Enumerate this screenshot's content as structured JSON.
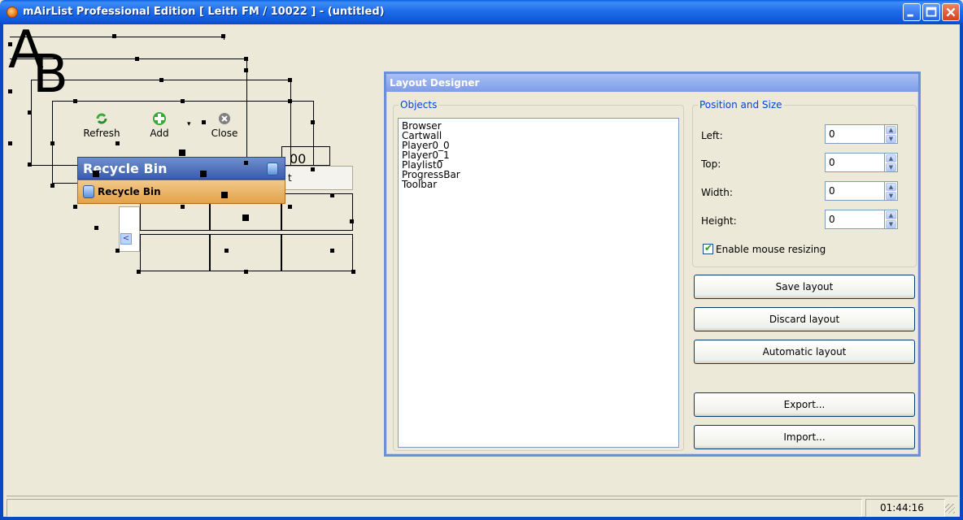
{
  "window": {
    "title": "mAirList Professional Edition [ Leith FM / 10022 ] - (untitled)",
    "controls": {
      "minimize": "minimize",
      "maximize": "maximize",
      "close": "close"
    }
  },
  "canvas": {
    "letter_a": "A",
    "letter_b": "B",
    "toolbar": {
      "refresh": "Refresh",
      "add": "Add",
      "close": "Close"
    },
    "counter_fragment": "00",
    "text_fragment": "t",
    "recycle_bin_header": "Recycle Bin",
    "recycle_bin_item": "Recycle Bin",
    "scroll_arrow": "<"
  },
  "layout_designer": {
    "title": "Layout Designer",
    "objects_label": "Objects",
    "objects": [
      "Browser",
      "Cartwall",
      "Player0_0",
      "Player0_1",
      "Playlist0",
      "ProgressBar",
      "Toolbar"
    ],
    "position_label": "Position and Size",
    "fields": {
      "left": {
        "label": "Left:",
        "value": "0"
      },
      "top": {
        "label": "Top:",
        "value": "0"
      },
      "width": {
        "label": "Width:",
        "value": "0"
      },
      "height": {
        "label": "Height:",
        "value": "0"
      }
    },
    "enable_mouse_resizing": {
      "label": "Enable mouse resizing",
      "checked": true
    },
    "buttons": {
      "save": "Save layout",
      "discard": "Discard layout",
      "automatic": "Automatic layout",
      "export": "Export...",
      "import": "Import..."
    }
  },
  "statusbar": {
    "clock": "01:44:16"
  },
  "colors": {
    "titlebar": "#0A5FE0",
    "dialog_border": "#6D8FD9",
    "group_label": "#0046D5",
    "recycle_header": "#3A5DAE",
    "recycle_item": "#E3A24A"
  }
}
